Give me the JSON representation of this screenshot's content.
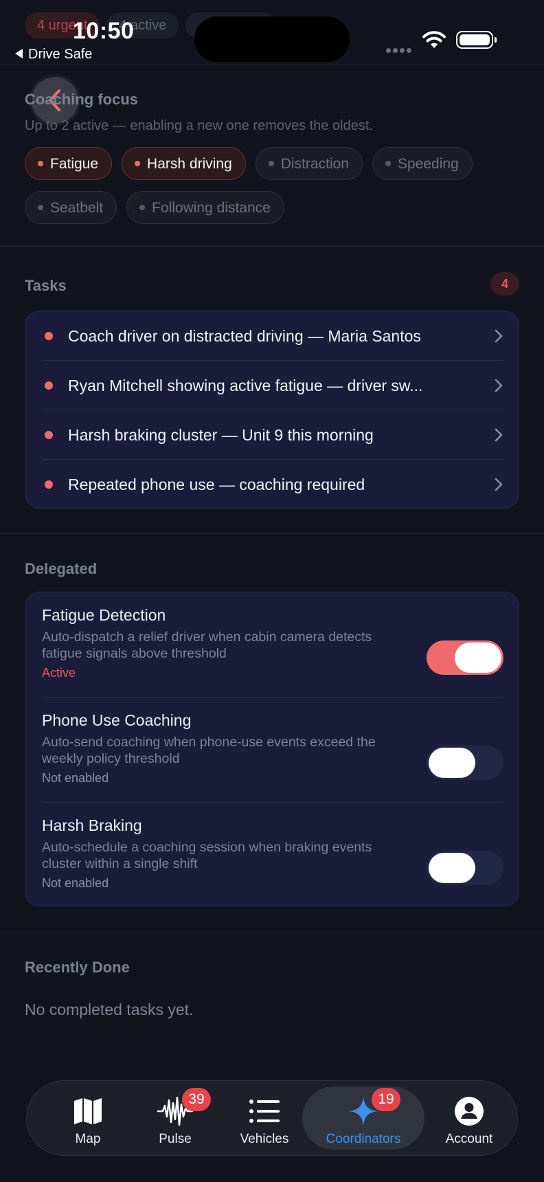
{
  "status_bar": {
    "time": "10:50",
    "back_app": "Drive Safe"
  },
  "summary_pills": [
    "4 urgent",
    "4 active"
  ],
  "focus": {
    "title": "Coaching focus",
    "subtitle": "Up to 2 active — enabling a new one removes the oldest.",
    "chips": [
      {
        "label": "Fatigue",
        "active": true
      },
      {
        "label": "Harsh driving",
        "active": true
      },
      {
        "label": "Distraction",
        "active": false
      },
      {
        "label": "Speeding",
        "active": false
      },
      {
        "label": "Seatbelt",
        "active": false
      },
      {
        "label": "Following distance",
        "active": false
      }
    ]
  },
  "tasks": {
    "title": "Tasks",
    "count": "4",
    "items": [
      {
        "text": "Coach driver on distracted driving — Maria Santos"
      },
      {
        "text": "Ryan Mitchell showing active fatigue — driver sw..."
      },
      {
        "text": "Harsh braking cluster — Unit 9 this morning"
      },
      {
        "text": "Repeated phone use — coaching required"
      }
    ]
  },
  "delegated": {
    "title": "Delegated",
    "items": [
      {
        "name": "Fatigue Detection",
        "description": "Auto-dispatch a relief driver when cabin camera detects fatigue signals above threshold",
        "status": "Active",
        "enabled": true
      },
      {
        "name": "Phone Use Coaching",
        "description": "Auto-send coaching when phone-use events exceed the weekly policy threshold",
        "status": "Not enabled",
        "enabled": false
      },
      {
        "name": "Harsh Braking",
        "description": "Auto-schedule a coaching session when braking events cluster within a single shift",
        "status": "Not enabled",
        "enabled": false
      }
    ]
  },
  "recently_done": {
    "title": "Recently Done",
    "empty": "No completed tasks yet."
  },
  "tabbar": {
    "tabs": [
      {
        "label": "Map",
        "icon": "map-icon"
      },
      {
        "label": "Pulse",
        "icon": "pulse-icon",
        "badge": "39"
      },
      {
        "label": "Vehicles",
        "icon": "list-icon"
      },
      {
        "label": "Coordinators",
        "icon": "sparkle-icon",
        "badge": "19",
        "active": true
      },
      {
        "label": "Account",
        "icon": "account-icon"
      }
    ]
  },
  "colors": {
    "background": "#11141c",
    "card": "#1a1c3a",
    "accent_red": "#ef6b6b",
    "active_blue": "#3d8ff0"
  }
}
